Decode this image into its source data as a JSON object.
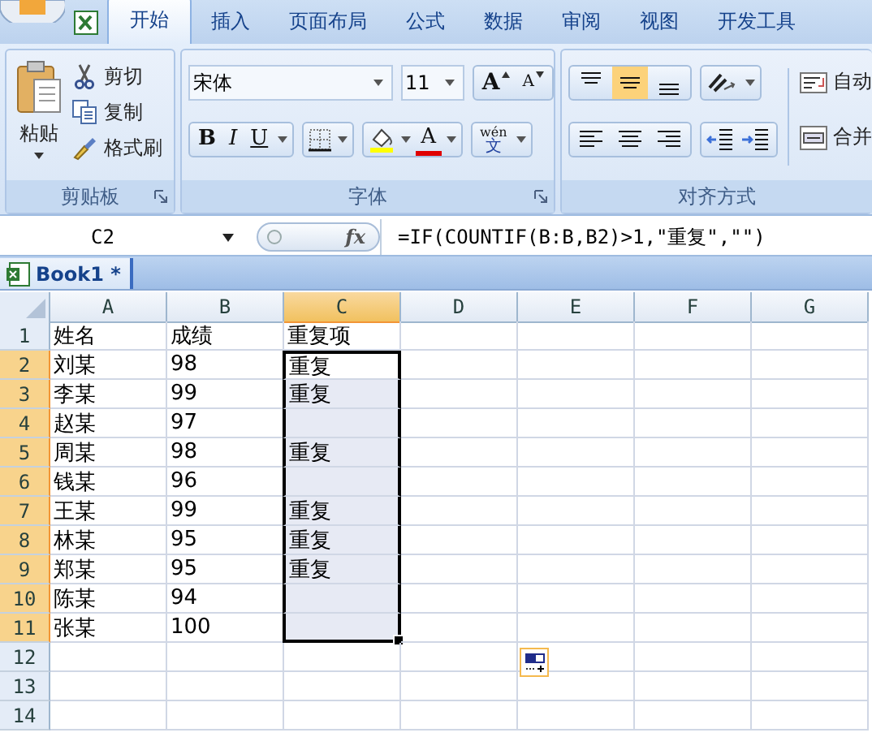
{
  "ribbon": {
    "tabs": [
      {
        "label": "开始",
        "selected": true
      },
      {
        "label": "插入",
        "selected": false
      },
      {
        "label": "页面布局",
        "selected": false
      },
      {
        "label": "公式",
        "selected": false
      },
      {
        "label": "数据",
        "selected": false
      },
      {
        "label": "审阅",
        "selected": false
      },
      {
        "label": "视图",
        "selected": false
      },
      {
        "label": "开发工具",
        "selected": false
      }
    ],
    "clipboard": {
      "title": "剪贴板",
      "paste": "粘贴",
      "items": [
        {
          "kind": "cut",
          "label": "剪切"
        },
        {
          "kind": "copy",
          "label": "复制"
        },
        {
          "kind": "painter",
          "label": "格式刷"
        }
      ]
    },
    "font": {
      "title": "字体",
      "font_name": "宋体",
      "font_size": "11",
      "grow": "A",
      "shrink": "A",
      "bold": "B",
      "italic": "I",
      "underline": "U",
      "font_color": "A",
      "phonetic_top": "wén",
      "phonetic_bottom": "文"
    },
    "alignment": {
      "title": "对齐方式",
      "vertical": [
        {
          "kind": "top",
          "selected": false
        },
        {
          "kind": "middle",
          "selected": true
        },
        {
          "kind": "bottom",
          "selected": false
        }
      ],
      "horizontal": [
        {
          "kind": "left",
          "selected": false
        },
        {
          "kind": "center",
          "selected": false
        },
        {
          "kind": "right",
          "selected": false
        }
      ],
      "wrap": "自动",
      "merge": "合并"
    }
  },
  "formula_bar": {
    "name_box": "C2",
    "fx": "fx",
    "formula": "=IF(COUNTIF(B:B,B2)>1,\"重复\",\"\")"
  },
  "workbook_tab": {
    "label": "Book1 *"
  },
  "sheet": {
    "columns": [
      {
        "label": "A",
        "selected": false
      },
      {
        "label": "B",
        "selected": false
      },
      {
        "label": "C",
        "selected": true
      },
      {
        "label": "D",
        "selected": false
      },
      {
        "label": "E",
        "selected": false
      },
      {
        "label": "F",
        "selected": false
      },
      {
        "label": "G",
        "selected": false
      }
    ],
    "rows": [
      {
        "label": "1",
        "selected": false,
        "name": "姓名",
        "score": "成绩",
        "duplicate": "重复项"
      },
      {
        "label": "2",
        "selected": true,
        "name": "刘某",
        "score": "98",
        "duplicate": "重复"
      },
      {
        "label": "3",
        "selected": true,
        "name": "李某",
        "score": "99",
        "duplicate": "重复"
      },
      {
        "label": "4",
        "selected": true,
        "name": "赵某",
        "score": "97"
      },
      {
        "label": "5",
        "selected": true,
        "name": "周某",
        "score": "98",
        "duplicate": "重复"
      },
      {
        "label": "6",
        "selected": true,
        "name": "钱某",
        "score": "96"
      },
      {
        "label": "7",
        "selected": true,
        "name": "王某",
        "score": "99",
        "duplicate": "重复"
      },
      {
        "label": "8",
        "selected": true,
        "name": "林某",
        "score": "95",
        "duplicate": "重复"
      },
      {
        "label": "9",
        "selected": true,
        "name": "郑某",
        "score": "95",
        "duplicate": "重复"
      },
      {
        "label": "10",
        "selected": true,
        "name": "陈某",
        "score": "94"
      },
      {
        "label": "11",
        "selected": true,
        "name": "张某",
        "score": "100"
      },
      {
        "label": "12",
        "selected": false
      },
      {
        "label": "13",
        "selected": false
      },
      {
        "label": "14",
        "selected": false
      }
    ]
  }
}
